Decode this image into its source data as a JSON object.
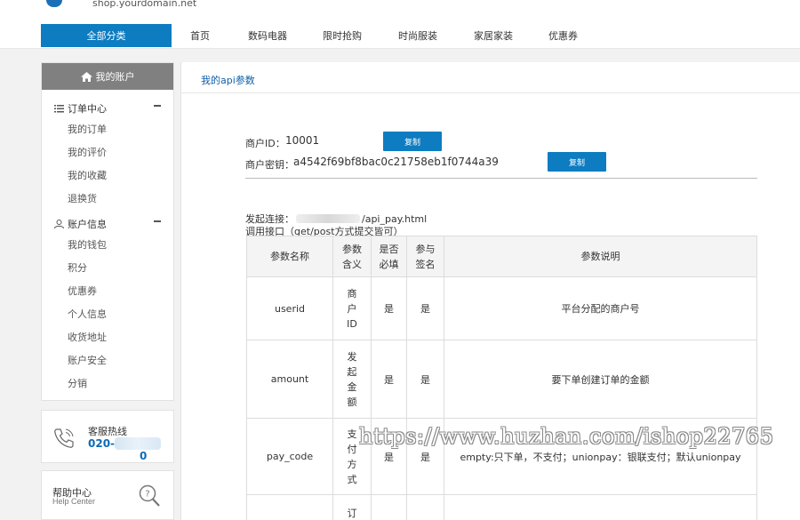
{
  "top": {
    "url_text": "shop.yourdomain.net"
  },
  "nav": {
    "all_categories": "全部分类",
    "items": [
      "首页",
      "数码电器",
      "限时抢购",
      "时尚服装",
      "家居家装",
      "优惠券"
    ]
  },
  "sidebar": {
    "header": "我的账户",
    "order_center": {
      "title": "订单中心",
      "items": [
        "我的订单",
        "我的评价",
        "我的收藏",
        "退换货"
      ]
    },
    "account_info": {
      "title": "账户信息",
      "items": [
        "我的钱包",
        "积分",
        "优惠券",
        "个人信息",
        "收货地址",
        "账户安全",
        "分销"
      ]
    }
  },
  "hotline": {
    "label": "客服热线",
    "number_start": "020-2",
    "number_end": "0"
  },
  "help": {
    "label": "帮助中心",
    "sub": "Help Center"
  },
  "main": {
    "breadcrumb": "我的api参数",
    "merchant_id_label": "商户ID：",
    "merchant_id": "10001",
    "merchant_key_label": "商户密钥：",
    "merchant_key": "a4542f69bf8bac0c21758eb1f0744a39",
    "copy_label": "复制",
    "init_label": "发起连接：",
    "init_url_suffix": "/api_pay.html",
    "call_label": "调用接口（get/post方式提交皆可）",
    "table": {
      "headers": [
        "参数名称",
        "参数含义",
        "是否必填",
        "参与签名",
        "参数说明"
      ],
      "rows": [
        {
          "name": "userid",
          "meaning": "商户ID",
          "required": "是",
          "signed": "是",
          "desc": "平台分配的商户号"
        },
        {
          "name": "amount",
          "meaning": "发起金额",
          "required": "是",
          "signed": "是",
          "desc": "要下单创建订单的金额"
        },
        {
          "name": "pay_code",
          "meaning": "支付方式",
          "required": "是",
          "signed": "是",
          "desc": "empty:只下单，不支付；unionpay：银联支付；默认unionpay"
        },
        {
          "name": "",
          "meaning": "订",
          "required": "",
          "signed": "",
          "desc": ""
        }
      ]
    }
  },
  "watermark": "https://www.huzhan.com/ishop22765"
}
